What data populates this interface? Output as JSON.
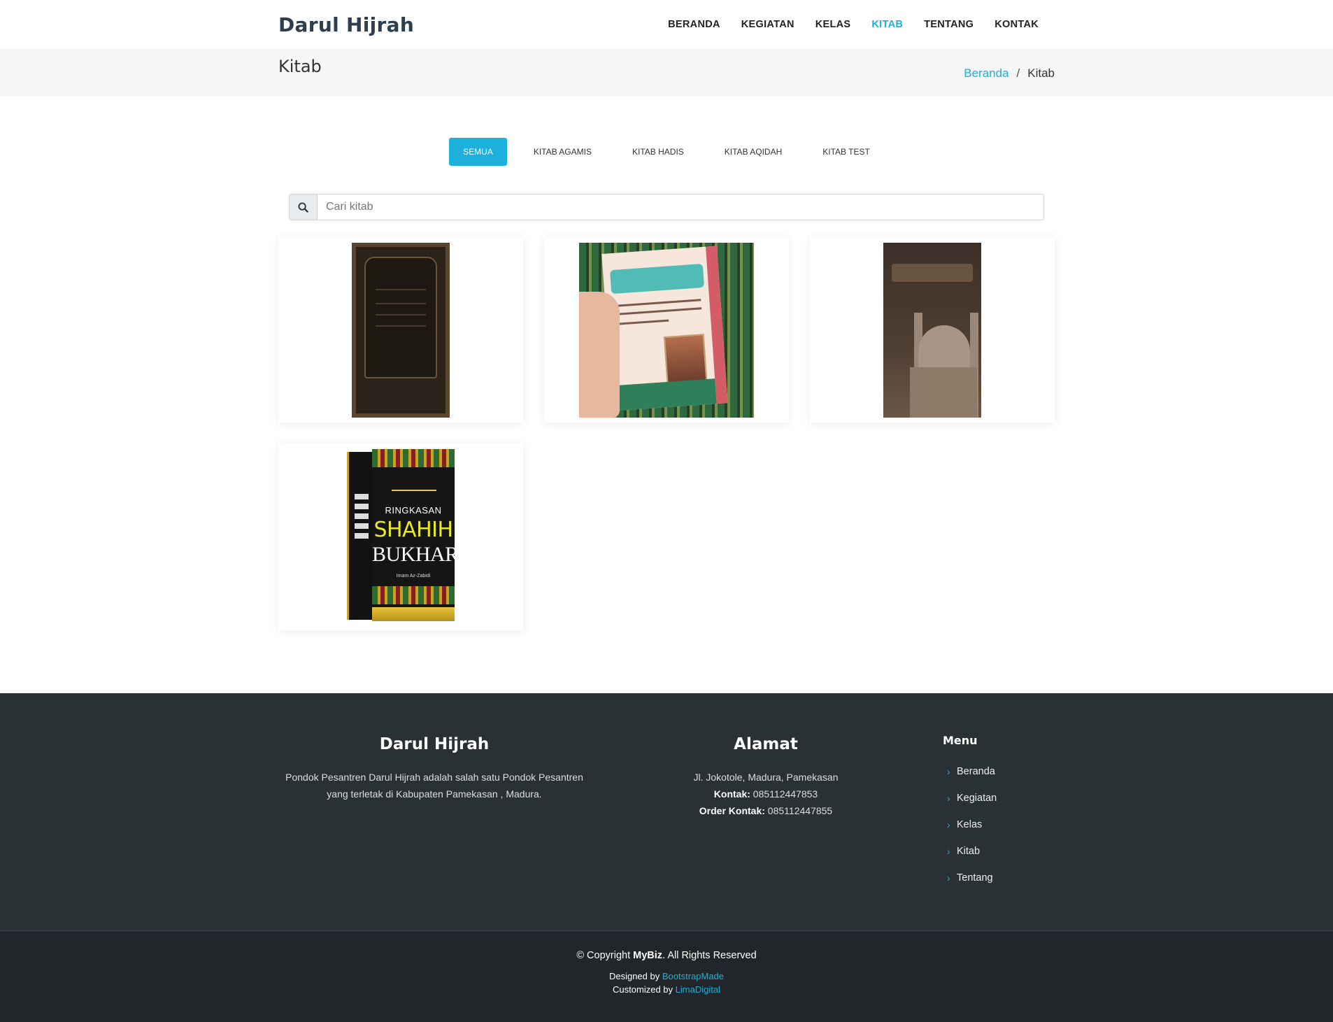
{
  "header": {
    "logo": "Darul Hijrah",
    "nav": [
      "BERANDA",
      "KEGIATAN",
      "KELAS",
      "KITAB",
      "TENTANG",
      "KONTAK"
    ],
    "active_nav": "KITAB"
  },
  "breadcrumbs": {
    "title": "Kitab",
    "home": "Beranda",
    "separator": "/",
    "current": "Kitab"
  },
  "filters": [
    "SEMUA",
    "KITAB AGAMIS",
    "KITAB HADIS",
    "KITAB AQIDAH",
    "KITAB TEST"
  ],
  "active_filter": "SEMUA",
  "search": {
    "placeholder": "Cari kitab",
    "icon": "search-icon"
  },
  "books": {
    "book4": {
      "line1": "RINGKASAN",
      "line2": "SHAHIH",
      "line3": "BUKHARI",
      "line4": "Imam Az-Zabidi"
    }
  },
  "footer": {
    "about": {
      "title": "Darul Hijrah",
      "text": "Pondok Pesantren Darul Hijrah adalah salah satu Pondok Pesantren yang terletak di Kabupaten Pamekasan , Madura."
    },
    "address": {
      "title": "Alamat",
      "street": "Jl. Jokotole, Madura, Pamekasan",
      "contact_label": "Kontak:",
      "contact_value": "085112447853",
      "order_label": "Order Kontak:",
      "order_value": "085112447855"
    },
    "menu": {
      "title": "Menu",
      "items": [
        "Beranda",
        "Kegiatan",
        "Kelas",
        "Kitab",
        "Tentang"
      ]
    }
  },
  "bottom": {
    "copyright_prefix": "© Copyright",
    "brand": "MyBiz",
    "copyright_suffix": ". All Rights Reserved",
    "designed_label": "Designed by",
    "designed_link": "BootstrapMade",
    "customized_label": "Customized by",
    "customized_link": "LimaDigital"
  },
  "colors": {
    "accent": "#1bb1dc",
    "footer_bg": "#2a3135",
    "footer_bottom_bg": "#20262a"
  }
}
